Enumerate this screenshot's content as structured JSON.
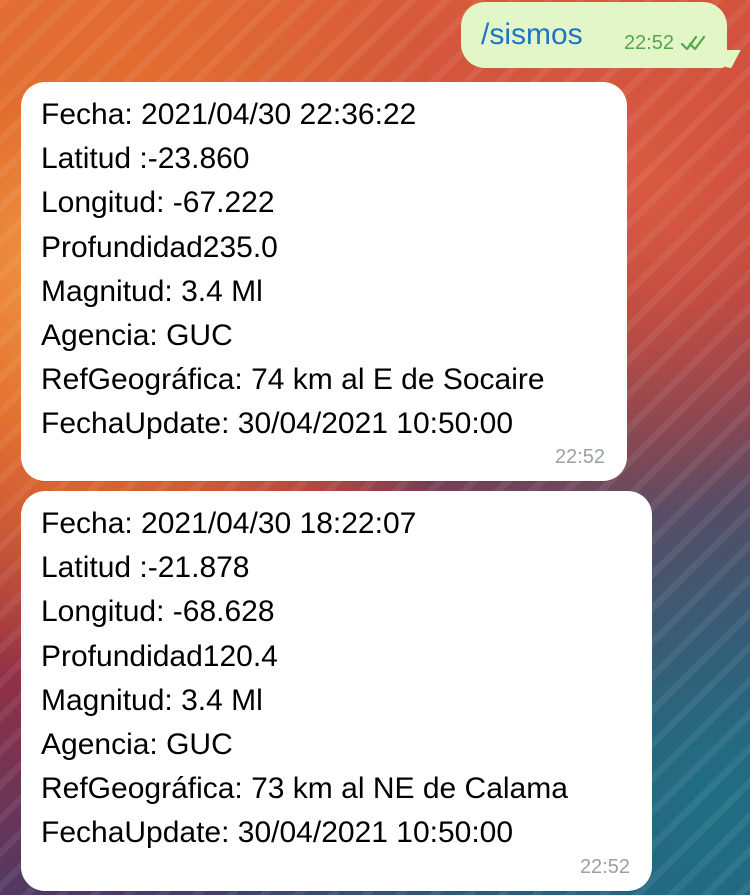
{
  "chat": {
    "messages": [
      {
        "direction": "outgoing",
        "text": "/sismos",
        "time": "22:52",
        "status_icon": "double-check-icon"
      },
      {
        "direction": "incoming",
        "lines": [
          "Fecha: 2021/04/30 22:36:22",
          "Latitud :-23.860",
          "Longitud: -67.222",
          "Profundidad235.0",
          "Magnitud: 3.4 Ml",
          "Agencia: GUC",
          "RefGeográfica: 74 km al E de Socaire",
          "FechaUpdate: 30/04/2021 10:50:00"
        ],
        "time": "22:52"
      },
      {
        "direction": "incoming",
        "lines": [
          "Fecha: 2021/04/30 18:22:07",
          "Latitud :-21.878",
          "Longitud: -68.628",
          "Profundidad120.4",
          "Magnitud: 3.4 Ml",
          "Agencia: GUC",
          "RefGeográfica: 73 km al NE de Calama",
          "FechaUpdate: 30/04/2021 10:50:00"
        ],
        "time": "22:52"
      }
    ]
  },
  "colors": {
    "outgoing_bubble": "#e3f6c7",
    "incoming_bubble": "#ffffff",
    "command_text": "#1f74c6",
    "outgoing_time": "#53a54a",
    "incoming_time": "#9aa0a6"
  }
}
